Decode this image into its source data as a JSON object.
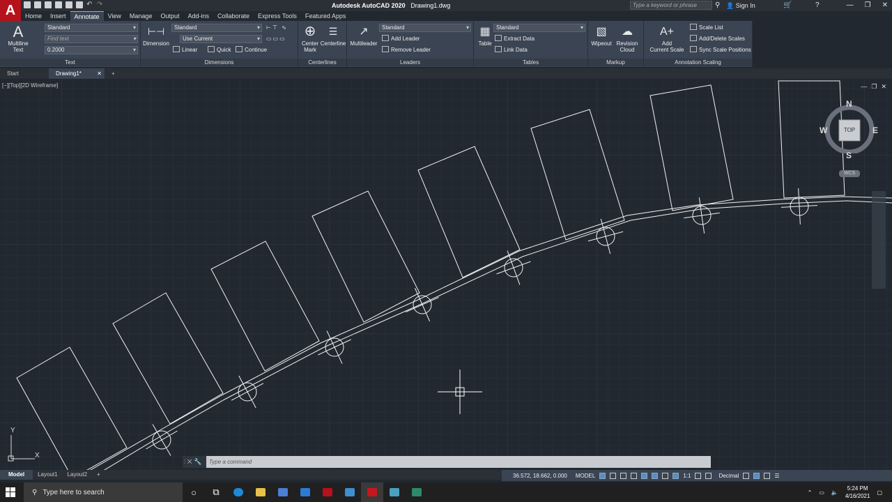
{
  "app": {
    "title_app": "Autodesk AutoCAD 2020",
    "title_file": "Drawing1.dwg",
    "search_placeholder": "Type a keyword or phrase",
    "sign_in": "Sign In"
  },
  "menu_tabs": [
    "Home",
    "Insert",
    "Annotate",
    "View",
    "Manage",
    "Output",
    "Add-ins",
    "Collaborate",
    "Express Tools",
    "Featured Apps"
  ],
  "ribbon": {
    "text_panel": {
      "title": "Text",
      "big_label_1": "Multiline",
      "big_label_2": "Text",
      "style": "Standard",
      "find_placeholder": "Find text",
      "height": "0.2000"
    },
    "dimensions_panel": {
      "title": "Dimensions",
      "big_label": "Dimension",
      "style": "Standard",
      "layer": "Use Current",
      "linear": "Linear",
      "quick": "Quick",
      "continue": "Continue"
    },
    "centerlines_panel": {
      "title": "Centerlines",
      "center_mark_1": "Center",
      "center_mark_2": "Mark",
      "centerline": "Centerline"
    },
    "leaders_panel": {
      "title": "Leaders",
      "big_label": "Multileader",
      "style": "Standard",
      "add_leader": "Add Leader",
      "remove_leader": "Remove Leader"
    },
    "tables_panel": {
      "title": "Tables",
      "big_label": "Table",
      "style": "Standard",
      "extract": "Extract Data",
      "link": "Link Data"
    },
    "markup_panel": {
      "title": "Markup",
      "wipeout": "Wipeout",
      "revision_1": "Revision",
      "revision_2": "Cloud"
    },
    "scaling_panel": {
      "title": "Annotation Scaling",
      "add_scale_1": "Add",
      "add_scale_2": "Current Scale",
      "scale_list": "Scale List",
      "add_delete": "Add/Delete Scales",
      "sync": "Sync Scale Positions"
    }
  },
  "file_tabs": {
    "start": "Start",
    "drawing": "Drawing1*"
  },
  "viewport": {
    "label": "[−][Top][2D Wireframe]",
    "viewcube": {
      "n": "N",
      "s": "S",
      "e": "E",
      "w": "W",
      "top": "TOP",
      "wcs": "WCS"
    },
    "ucs_x": "X",
    "ucs_y": "Y"
  },
  "command": {
    "placeholder": "Type a command"
  },
  "layout_tabs": [
    "Model",
    "Layout1",
    "Layout2"
  ],
  "status": {
    "coords": "36.572, 18.662, 0.000",
    "model": "MODEL",
    "scale": "1:1",
    "units": "Decimal"
  },
  "taskbar": {
    "search": "Type here to search",
    "time": "5:24 PM",
    "date": "4/16/2021"
  },
  "colors": {
    "accent": "#b5121b",
    "ribbon": "#3b4453",
    "canvas": "#212830"
  }
}
